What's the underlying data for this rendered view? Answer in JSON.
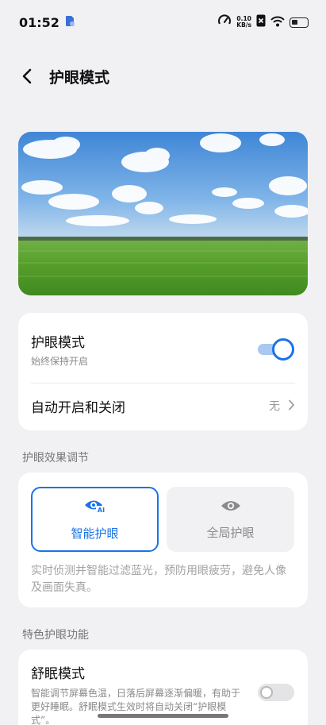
{
  "status_bar": {
    "time": "01:52",
    "net_speed_value": "0.10",
    "net_speed_unit": "KB/s",
    "battery_level": 0.3
  },
  "header": {
    "title": "护眼模式"
  },
  "eye_care_card": {
    "toggle_title": "护眼模式",
    "toggle_subtitle": "始终保持开启",
    "toggle_on": true,
    "auto_title": "自动开启和关闭",
    "auto_value": "无"
  },
  "adjust_section": {
    "label": "护眼效果调节",
    "modes": [
      {
        "label": "智能护眼",
        "badge": "AI",
        "selected": true,
        "icon": "eye-ai-icon"
      },
      {
        "label": "全局护眼",
        "selected": false,
        "icon": "eye-icon"
      }
    ],
    "description": "实时侦测并智能过滤蓝光，预防用眼疲劳，避免人像及画面失真。"
  },
  "features_section": {
    "label": "特色护眼功能",
    "sleep_title": "舒眠模式",
    "sleep_desc": "智能调节屏幕色温，日落后屏幕逐渐偏暖，有助于更好睡眠。舒眠模式生效时将自动关闭“护眼模式”。",
    "sleep_on": false
  },
  "colors": {
    "accent": "#1a73e8",
    "background": "#f1f1f3",
    "card": "#ffffff"
  }
}
